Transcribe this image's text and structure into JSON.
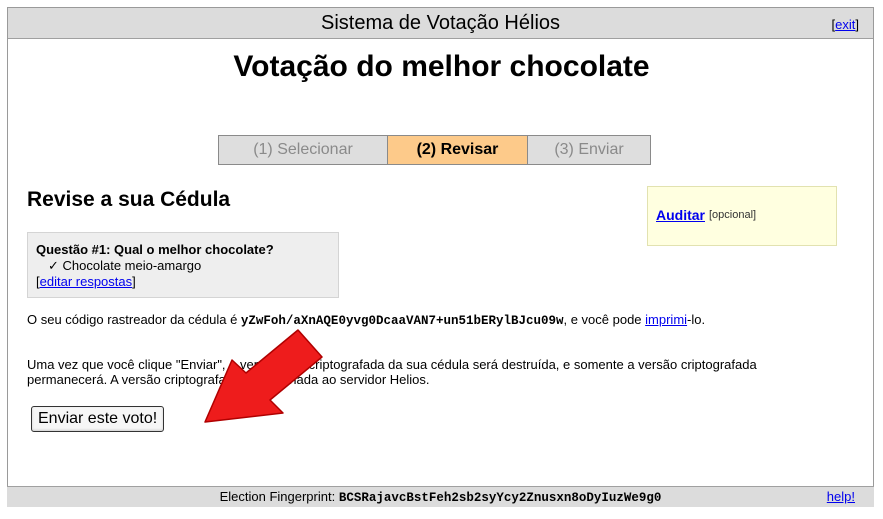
{
  "header": {
    "system_title": "Sistema de Votação Hélios",
    "exit_label": "exit"
  },
  "election": {
    "title": "Votação do melhor chocolate"
  },
  "steps": [
    {
      "label": "(1) Selecionar",
      "state": "inactive"
    },
    {
      "label": "(2) Revisar",
      "state": "active"
    },
    {
      "label": "(3) Enviar",
      "state": "inactive"
    }
  ],
  "review": {
    "heading": "Revise a sua Cédula"
  },
  "audit": {
    "link_label": "Auditar",
    "optional_label": "[opcional]"
  },
  "question": {
    "title": "Questão #1: Qual o melhor chocolate?",
    "answer": "✓ Chocolate meio-amargo",
    "edit_label": "editar respostas"
  },
  "tracker": {
    "prefix": "O seu código rastreador da cédula é ",
    "hash": "yZwFoh/aXnAQE0yvg0DcaaVAN7+un51bERylBJcu09w",
    "middle": ", e você pode ",
    "print_link": "imprimi",
    "suffix": "-lo."
  },
  "notice": {
    "text": "Uma vez que você clique \"Enviar\", a versão não-criptografada da sua cédula será destruída, e somente a versão criptografada permanecerá. A versão criptografada será enviada ao servidor Helios."
  },
  "submit": {
    "label": "Enviar este voto!"
  },
  "footer": {
    "fingerprint_label": "Election Fingerprint: ",
    "fingerprint_hash": "BCSRajavcBstFeh2sb2syYcy2Znusxn8oDyIuzWe9g0",
    "help_label": "help!"
  },
  "colors": {
    "bar_gray": "#dcdcdc",
    "active_step": "#fdca8a",
    "audit_bg": "#ffffe0",
    "question_bg": "#eeeeee",
    "arrow_red": "#ee1c1c",
    "link_blue": "#0000ee"
  },
  "icons": [
    "red-arrow-icon",
    "checkmark-icon"
  ]
}
